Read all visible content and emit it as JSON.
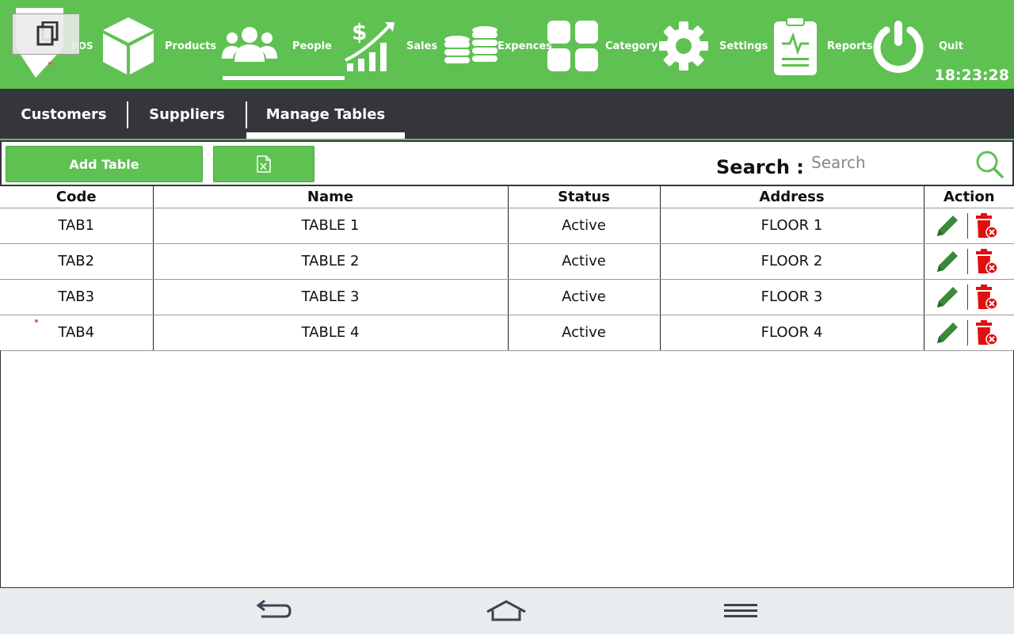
{
  "nav": {
    "items": [
      {
        "label": "POS",
        "icon": "pos-icon"
      },
      {
        "label": "Products",
        "icon": "box-icon"
      },
      {
        "label": "People",
        "icon": "people-icon"
      },
      {
        "label": "Sales",
        "icon": "sales-chart-icon"
      },
      {
        "label": "Expences",
        "icon": "coins-icon"
      },
      {
        "label": "Category",
        "icon": "grid-icon"
      },
      {
        "label": "Settings",
        "icon": "gear-icon"
      },
      {
        "label": "Reports",
        "icon": "report-icon"
      },
      {
        "label": "Quit",
        "icon": "power-icon"
      }
    ],
    "active": "People",
    "clock": "18:23:28"
  },
  "tabs": [
    {
      "label": "Customers"
    },
    {
      "label": "Suppliers"
    },
    {
      "label": "Manage Tables"
    }
  ],
  "active_tab": "Manage Tables",
  "toolbar": {
    "add_label": "Add Table",
    "export_icon": "excel-icon",
    "search_label": "Search :",
    "search_placeholder": "Search"
  },
  "table": {
    "headers": [
      "Code",
      "Name",
      "Status",
      "Address",
      "Action"
    ],
    "rows": [
      {
        "code": "TAB1",
        "name": "TABLE 1",
        "status": "Active",
        "address": "FLOOR 1"
      },
      {
        "code": "TAB2",
        "name": "TABLE 2",
        "status": "Active",
        "address": "FLOOR 2"
      },
      {
        "code": "TAB3",
        "name": "TABLE 3",
        "status": "Active",
        "address": "FLOOR 3"
      },
      {
        "code": "TAB4",
        "name": "TABLE 4",
        "status": "Active",
        "address": "FLOOR 4"
      }
    ]
  },
  "colors": {
    "brand_green": "#5fc152",
    "dark_bar": "#35363b",
    "edit_green": "#3a8a3a",
    "delete_red": "#e01010"
  }
}
